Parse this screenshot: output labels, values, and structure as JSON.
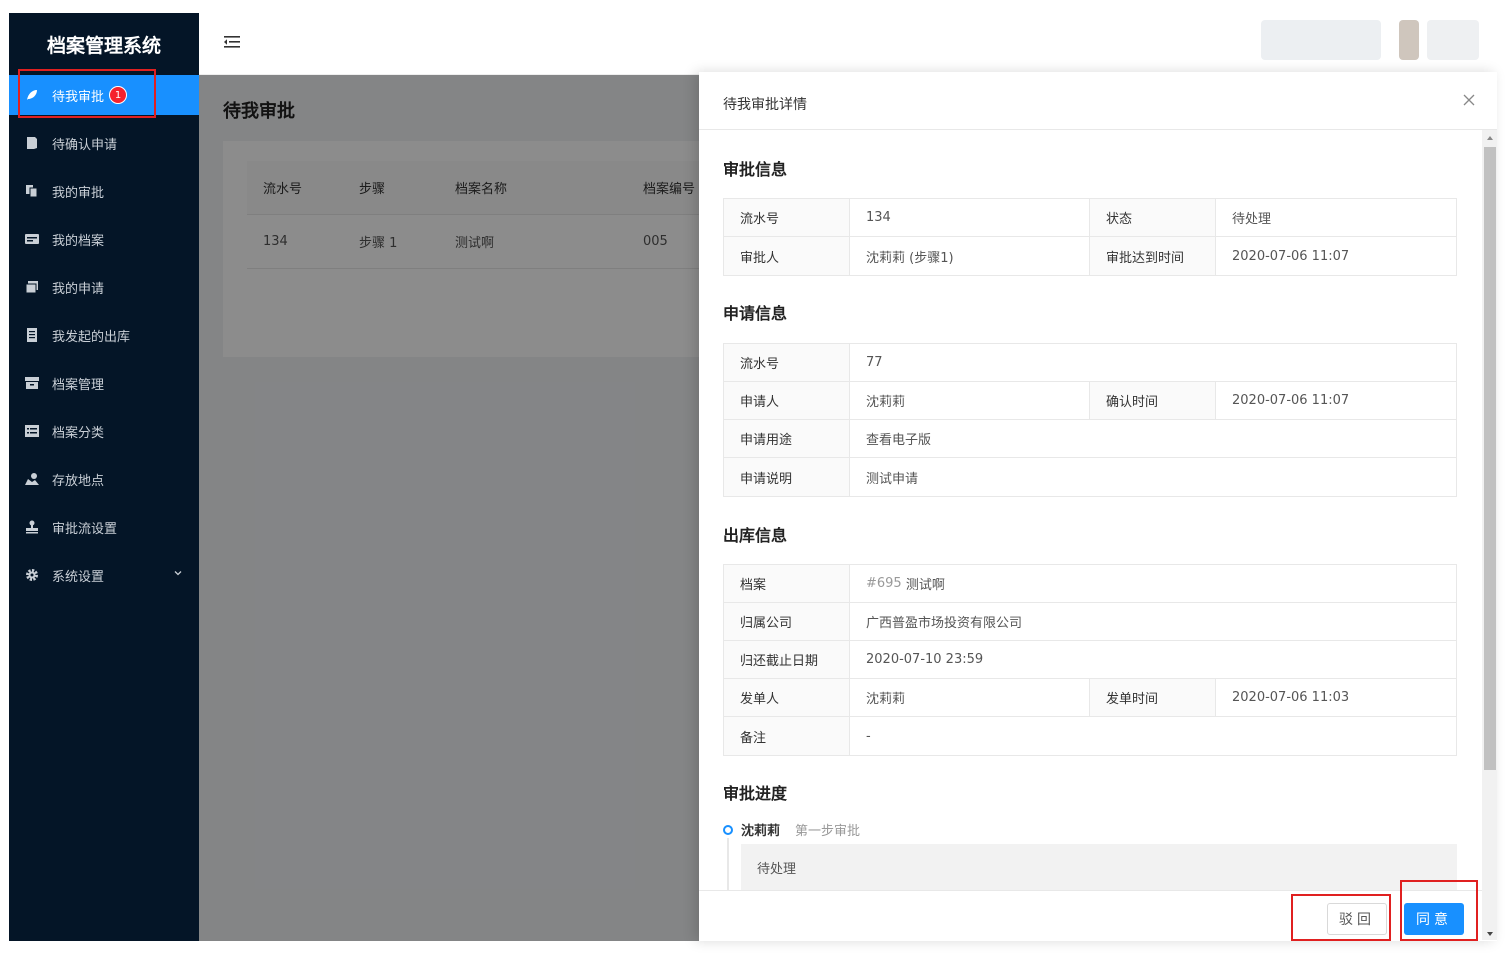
{
  "app": {
    "title": "档案管理系统"
  },
  "sidebar": {
    "items": [
      {
        "label": "待我审批",
        "icon": "feather-icon",
        "badge": "1",
        "active": true
      },
      {
        "label": "待确认申请",
        "icon": "file-icon"
      },
      {
        "label": "我的审批",
        "icon": "copy-icon"
      },
      {
        "label": "我的档案",
        "icon": "card-icon"
      },
      {
        "label": "我的申请",
        "icon": "stack-icon"
      },
      {
        "label": "我发起的出库",
        "icon": "document-icon"
      },
      {
        "label": "档案管理",
        "icon": "archive-icon"
      },
      {
        "label": "档案分类",
        "icon": "list-icon"
      },
      {
        "label": "存放地点",
        "icon": "location-icon"
      },
      {
        "label": "审批流设置",
        "icon": "stamp-icon"
      },
      {
        "label": "系统设置",
        "icon": "gear-icon"
      }
    ]
  },
  "main": {
    "title": "待我审批",
    "table": {
      "headers": [
        "流水号",
        "步骤",
        "档案名称",
        "档案编号"
      ],
      "rows": [
        [
          "134",
          "步骤 1",
          "测试啊",
          "005"
        ]
      ]
    }
  },
  "drawer": {
    "title": "待我审批详情",
    "sections": {
      "approval": {
        "title": "审批信息",
        "serial_label": "流水号",
        "serial_value": "134",
        "status_label": "状态",
        "status_value": "待处理",
        "approver_label": "审批人",
        "approver_value": "沈莉莉 (步骤1)",
        "arrive_label": "审批达到时间",
        "arrive_value": "2020-07-06 11:07"
      },
      "application": {
        "title": "申请信息",
        "serial_label": "流水号",
        "serial_value": "77",
        "applicant_label": "申请人",
        "applicant_value": "沈莉莉",
        "confirm_label": "确认时间",
        "confirm_value": "2020-07-06 11:07",
        "purpose_label": "申请用途",
        "purpose_value": "查看电子版",
        "desc_label": "申请说明",
        "desc_value": "测试申请"
      },
      "outbound": {
        "title": "出库信息",
        "archive_label": "档案",
        "archive_id": "#695",
        "archive_name": "测试啊",
        "company_label": "归属公司",
        "company_value": "广西普盈市场投资有限公司",
        "deadline_label": "归还截止日期",
        "deadline_value": "2020-07-10 23:59",
        "issuer_label": "发单人",
        "issuer_value": "沈莉莉",
        "issue_time_label": "发单时间",
        "issue_time_value": "2020-07-06 11:03",
        "remark_label": "备注",
        "remark_value": "-"
      },
      "progress": {
        "title": "审批进度",
        "name": "沈莉莉",
        "step": "第一步审批",
        "state": "待处理"
      }
    },
    "buttons": {
      "reject": "驳回",
      "agree": "同意"
    }
  },
  "colors": {
    "sidebar_bg": "#041527",
    "primary": "#1890ff",
    "badge": "#f5222d",
    "highlight": "#e02020"
  }
}
